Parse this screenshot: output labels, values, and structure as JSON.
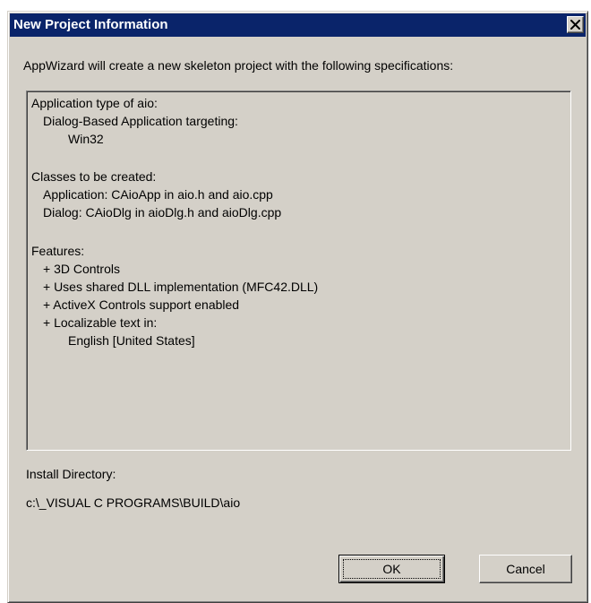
{
  "window": {
    "title": "New Project Information",
    "close_icon": "close-icon"
  },
  "intro_text": "AppWizard will create a new skeleton project with the following specifications:",
  "specifications": {
    "app_type_heading": "Application type of aio:",
    "app_type_value": "Dialog-Based Application targeting:",
    "app_target": "Win32",
    "classes_heading": "Classes to be created:",
    "class_application": "Application: CAioApp in aio.h and aio.cpp",
    "class_dialog": "Dialog: CAioDlg in aioDlg.h and aioDlg.cpp",
    "features_heading": "Features:",
    "feature_3d": "+ 3D Controls",
    "feature_dll": "+ Uses shared DLL implementation (MFC42.DLL)",
    "feature_activex": "+ ActiveX Controls support enabled",
    "feature_localizable": "+ Localizable text in:",
    "feature_language": "English [United States]"
  },
  "install": {
    "label": "Install Directory:",
    "path": "c:\\_VISUAL C PROGRAMS\\BUILD\\aio"
  },
  "buttons": {
    "ok_label": "OK",
    "cancel_label": "Cancel"
  },
  "colors": {
    "titlebar": "#0a246a",
    "face": "#d4d0c8",
    "title_text": "#ffffff"
  }
}
